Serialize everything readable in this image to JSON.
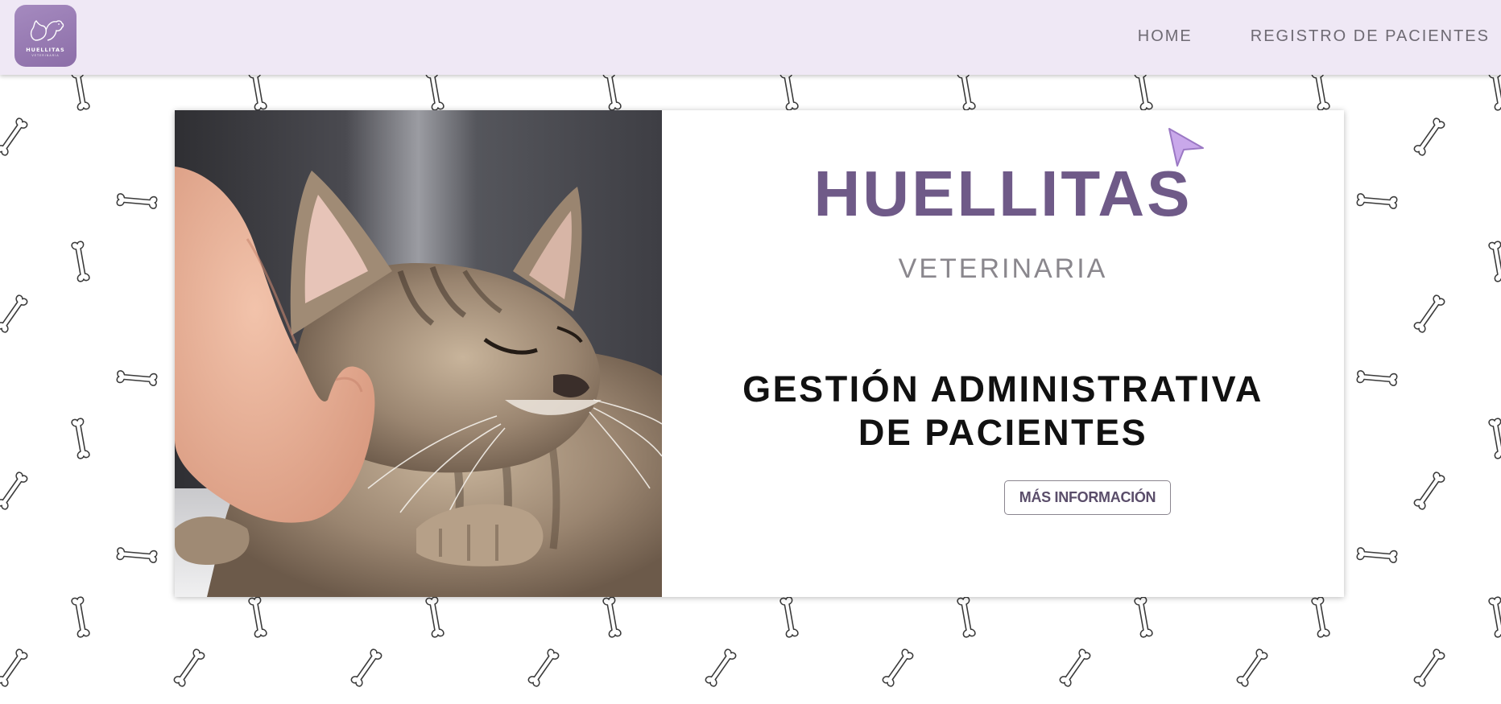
{
  "brand": {
    "logo_text": "HUELLITAS",
    "logo_subtext": "VETERINARIA",
    "logo_color": "#9a7db5"
  },
  "nav": {
    "items": [
      {
        "label": "HOME"
      },
      {
        "label": "REGISTRO DE PACIENTES"
      }
    ],
    "background_color": "#efe8f5"
  },
  "hero": {
    "title": "HUELLITAS",
    "subtitle": "VETERINARIA",
    "heading_line1": "GESTIÓN ADMINISTRATIVA",
    "heading_line2": "DE PACIENTES",
    "button_label": "MÁS INFORMACIÓN",
    "title_color": "#6f5a88",
    "image_subject": "cat-being-petted-photo"
  },
  "background": {
    "pattern_icon": "bone-icon"
  }
}
